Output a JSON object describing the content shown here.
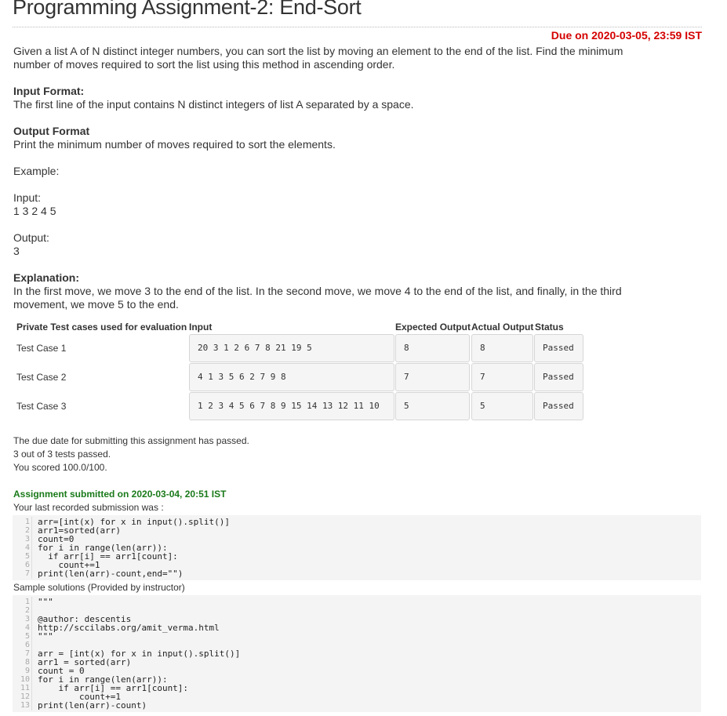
{
  "title": "Programming Assignment-2: End-Sort",
  "due": "Due on 2020-03-05, 23:59 IST",
  "description_line1": "Given a list A of N distinct integer numbers, you can sort the list by moving an element to the end of the list. Find the minimum",
  "description_line2": "number of moves required to sort the list using this method in ascending order.",
  "input_format_heading": "Input Format:",
  "input_format_text": "The first line of the input contains N distinct integers of list A separated by a space.",
  "output_format_heading": "Output Format",
  "output_format_text": "Print the minimum number of moves required to sort the elements.",
  "example_label": "Example:",
  "input_label": "Input:",
  "input_value": "1 3 2 4 5",
  "output_label": "Output:",
  "output_value": "3",
  "explanation_heading": "Explanation:",
  "explanation_line1": "In the first move, we move 3 to the end of the list. In the second move, we move 4 to the end of the list, and finally, in the third",
  "explanation_line2": "movement, we move 5 to the end.",
  "table": {
    "headers": [
      "Private Test cases used for evaluation",
      "Input",
      "Expected Output",
      "Actual Output",
      "Status"
    ],
    "rows": [
      {
        "name": "Test Case 1",
        "input": "20 3 1 2 6 7 8 21 19 5",
        "expected": "8",
        "actual": "8",
        "status": "Passed"
      },
      {
        "name": "Test Case 2",
        "input": "4 1 3 5 6 2 7 9 8",
        "expected": "7",
        "actual": "7",
        "status": "Passed"
      },
      {
        "name": "Test Case 3",
        "input": "1 2 3 4 5 6 7 8 9 15 14 13 12 11 10",
        "expected": "5",
        "actual": "5",
        "status": "Passed"
      }
    ]
  },
  "due_passed": "The due date for submitting this assignment has passed.",
  "tests_passed": "3 out of 3 tests passed.",
  "score": "You scored 100.0/100.",
  "submitted": "Assignment submitted on 2020-03-04, 20:51 IST",
  "last_submission_label": "Your last recorded submission was :",
  "submission_code": [
    "arr=[int(x) for x in input().split()]",
    "arr1=sorted(arr)",
    "count=0",
    "for i in range(len(arr)):",
    "  if arr[i] == arr1[count]:",
    "    count+=1",
    "print(len(arr)-count,end=\"\")"
  ],
  "sample_label": "Sample solutions (Provided by instructor)",
  "sample_code": [
    "\"\"\"",
    "",
    "@author: descentis",
    "http://sccilabs.org/amit_verma.html",
    "\"\"\"",
    "",
    "arr = [int(x) for x in input().split()]",
    "arr1 = sorted(arr)",
    "count = 0",
    "for i in range(len(arr)):",
    "    if arr[i] == arr1[count]:",
    "        count+=1",
    "print(len(arr)-count)"
  ]
}
